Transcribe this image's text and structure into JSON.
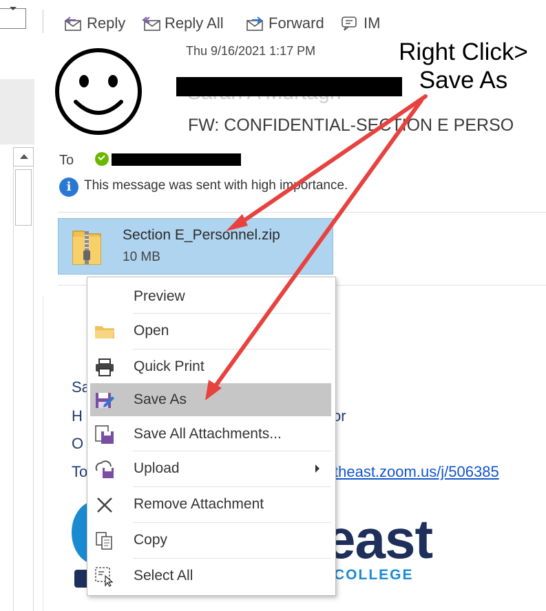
{
  "toolbar": {
    "reply": "Reply",
    "reply_all": "Reply All",
    "forward": "Forward",
    "im": "IM"
  },
  "message": {
    "date": "Thu 9/16/2021 1:17 PM",
    "sender_partial": "Sarah A Murtagh",
    "subject": "FW: CONFIDENTIAL-SECTION E PERSO",
    "to_label": "To",
    "importance_notice": "This message was sent with high importance."
  },
  "attachment": {
    "name": "Section E_Personnel.zip",
    "size": "10 MB"
  },
  "context_menu": {
    "items": [
      {
        "label": "Preview",
        "icon": "preview-icon"
      },
      {
        "label": "Open",
        "icon": "folder-icon"
      },
      {
        "label": "Quick Print",
        "icon": "printer-icon"
      },
      {
        "label": "Save As",
        "icon": "save-as-icon",
        "selected": true
      },
      {
        "label": "Save All Attachments...",
        "icon": "save-all-icon"
      },
      {
        "label": "Upload",
        "icon": "upload-icon",
        "has_submenu": true
      },
      {
        "label": "Remove Attachment",
        "icon": "remove-icon"
      },
      {
        "label": "Copy",
        "icon": "copy-icon"
      },
      {
        "label": "Select All",
        "icon": "select-all-icon"
      }
    ]
  },
  "body": {
    "line1": "Sa",
    "line2": "H",
    "line2_end": "or",
    "line3": "O",
    "line4": "To",
    "link": "theast.zoom.us/j/506385",
    "logo_word": "east",
    "logo_college": "COLLEGE"
  },
  "annotation": {
    "line1": "Right Click>",
    "line2": "Save As"
  },
  "colors": {
    "attachment_bg": "#aed4ef",
    "selected_item": "#c6c6c6",
    "arrow": "#e8423f",
    "presence": "#6bb700",
    "logo_navy": "#1d2f5a",
    "logo_blue": "#1a8bd0"
  }
}
